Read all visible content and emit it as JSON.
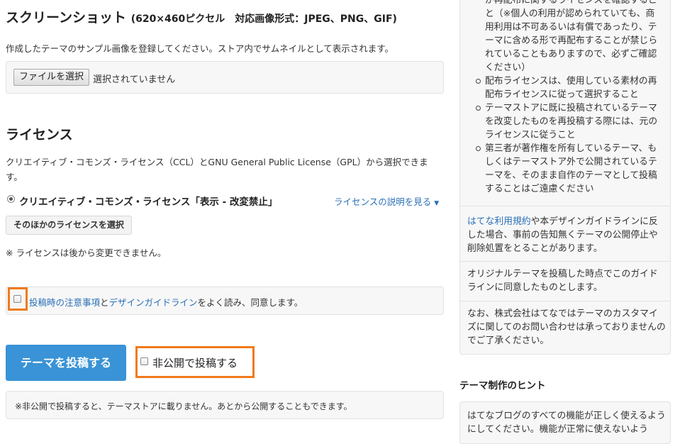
{
  "screenshot": {
    "title": "スクリーンショット",
    "spec": "(620×460ピクセル　対応画像形式：JPEG、PNG、GIF)",
    "description": "作成したテーマのサンプル画像を登録してください。ストア内でサムネイルとして表示されます。",
    "file_button": "ファイルを選択",
    "file_status": "選択されていません"
  },
  "license": {
    "title": "ライセンス",
    "description": "クリエイティブ・コモンズ・ライセンス（CCL）とGNU General Public License（GPL）から選択できます。",
    "selected": "クリエイティブ・コモンズ・ライセンス「表示 - 改変禁止」",
    "explain_link": "ライセンスの説明を見る",
    "other_button": "そのほかのライセンスを選択",
    "note": "※ ライセンスは後から変更できません。"
  },
  "agree": {
    "link1": "投稿時の注意事項",
    "and": "と",
    "link2": "デザインガイドライン",
    "suffix": "をよく読み、同意します。"
  },
  "submit": {
    "post_button": "テーマを投稿する",
    "private_label": "非公開で投稿する",
    "private_note": "※非公開で投稿すると、テーマストアに載りません。あとから公開することもできます。"
  },
  "sidebar": {
    "continued": "が再配布に関するライセンスを確認すること（※個人の利用が認められていても、商用利用は不可あるいは有償であったり、テーマに含める形で再配布することが禁じられていることもありますので、必ずご確認ください）",
    "items": [
      "配布ライセンスは、使用している素材の再配布ライセンスに従って選択すること",
      "テーマストアに既に投稿されているテーマを改変したものを再投稿する際には、元のライセンスに従うこと",
      "第三者が著作権を所有しているテーマ、もしくはテーマストア外で公開されているテーマを、そのまま自作のテーマとして投稿することはご遠慮ください"
    ],
    "terms_link": "はてな利用規約",
    "terms_text": "や本デザインガイドラインに反した場合、事前の告知無くテーマの公開停止や削除処置をとることがあります。",
    "agree_text": "オリジナルテーマを投稿した時点でこのガイドラインに同意したものとします。",
    "support_text": "なお、株式会社はてなではテーマのカスタマイズに関してのお問い合わせは承っておりませんのでご了承ください。",
    "hint_title": "テーマ制作のヒント",
    "hint_text": "はてなブログのすべての機能が正しく使えるようにしてください。機能が正常に使えないよう"
  },
  "colors": {
    "accent": "#3993d6",
    "link": "#2a6fb7",
    "highlight": "#f07a1e"
  }
}
